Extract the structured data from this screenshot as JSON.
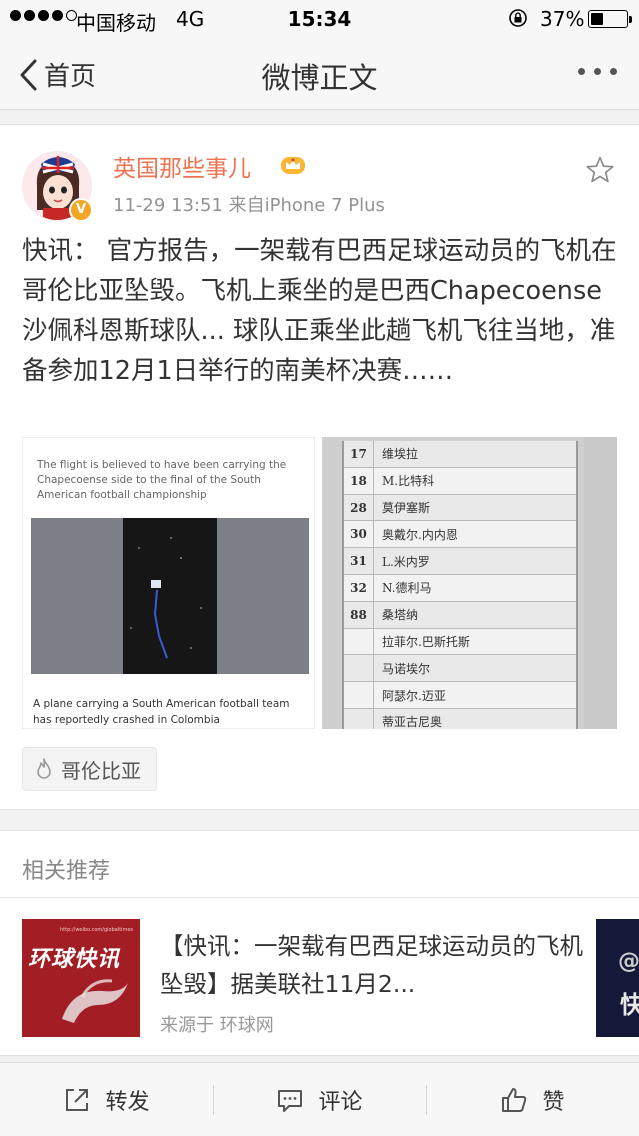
{
  "status_bar": {
    "carrier": "中国移动",
    "network": "4G",
    "time": "15:34",
    "battery_text": "37%",
    "battery_level": 0.37,
    "signal_bars_filled": 4,
    "signal_bars_total": 5
  },
  "nav": {
    "back_label": "首页",
    "title": "微博正文"
  },
  "post": {
    "author": "英国那些事儿",
    "meta": "11-29 13:51  来自iPhone 7 Plus",
    "text": "快讯： 官方报告，一架载有巴西足球运动员的飞机在哥伦比亚坠毁。飞机上乘坐的是巴西Chapecoense 沙佩科恩斯球队... 球队正乘坐此趟飞机飞往当地，准备参加12月1日举行的南美杯决赛……",
    "image_left": {
      "caption_top": "The flight is believed to have been carrying the Chapecoense side to the final of the South American football championship",
      "caption_bottom": "A plane carrying a South American football team has reportedly crashed in Colombia"
    },
    "image_right_rows": [
      {
        "num": "17",
        "name": "维埃拉"
      },
      {
        "num": "18",
        "name": "M.比特科"
      },
      {
        "num": "28",
        "name": "莫伊塞斯"
      },
      {
        "num": "30",
        "name": "奥戴尔.内内恩"
      },
      {
        "num": "31",
        "name": "L.米内罗"
      },
      {
        "num": "32",
        "name": "N.德利马"
      },
      {
        "num": "88",
        "name": "桑塔纳"
      },
      {
        "num": "",
        "name": "拉菲尔.巴斯托斯"
      },
      {
        "num": "",
        "name": "马诺埃尔"
      },
      {
        "num": "",
        "name": "阿瑟尔.迈亚"
      },
      {
        "num": "",
        "name": "蒂亚古尼奥"
      }
    ],
    "topic_tag": "哥伦比亚"
  },
  "recommend": {
    "header": "相关推荐",
    "thumb_text": "环球快讯",
    "thumb_url": "http://weibo.com/globaltimes",
    "title": "【快讯：一架载有巴西足球运动员的飞机坠毁】据美联社11月2...",
    "source": "来源于 环球网",
    "peek_text": "@",
    "peek_char": "快"
  },
  "toolbar": {
    "repost": "转发",
    "comment": "评论",
    "like": "赞"
  },
  "colors": {
    "author": "#eb7350",
    "verified_badge": "#f5a623",
    "thumb_red": "#a31d24"
  }
}
